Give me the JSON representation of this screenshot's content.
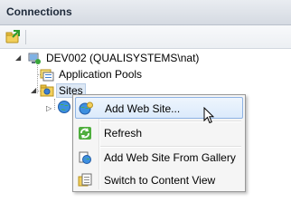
{
  "header": {
    "title": "Connections"
  },
  "toolbar": {
    "buttons": [
      {
        "icon": "connect-icon"
      }
    ]
  },
  "tree": {
    "server": {
      "label": "DEV002 (QUALISYSTEMS\\nat)",
      "expander": "◢"
    },
    "app_pools": {
      "label": "Application Pools"
    },
    "sites": {
      "label": "Sites",
      "expander": "◢"
    },
    "child_expander": "▷"
  },
  "context_menu": {
    "items": [
      {
        "label": "Add Web Site...",
        "icon": "add-website-icon"
      },
      {
        "label": "Refresh",
        "icon": "refresh-icon"
      },
      {
        "label": "Add Web Site From Gallery",
        "icon": "gallery-icon"
      },
      {
        "label": "Switch to Content View",
        "icon": "content-view-icon"
      }
    ]
  },
  "colors": {
    "menu_hover": "#dbeafb",
    "menu_hover_border": "#8db2e3",
    "header_text": "#1e2a3a"
  }
}
